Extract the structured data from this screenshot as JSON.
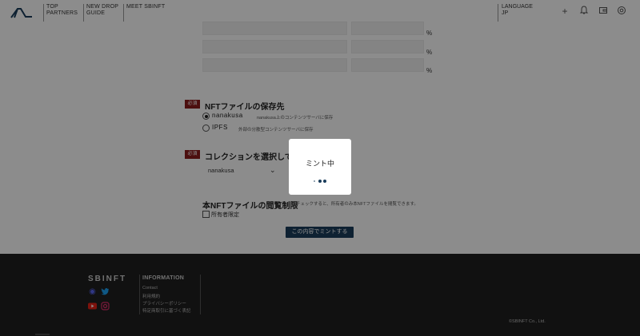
{
  "header": {
    "nav": [
      {
        "line1": "TOP",
        "line2": "PARTNERS"
      },
      {
        "line1": "NEW DROP",
        "line2": "GUIDE"
      },
      {
        "line1": "MEET SBINFT",
        "line2": ""
      }
    ],
    "language_label": "LANGUAGE",
    "language_value": "JP",
    "icons": [
      "plus-icon",
      "bell-icon",
      "wallet-icon",
      "settings-icon"
    ]
  },
  "form": {
    "percent_unit": "%",
    "required_badge": "必須",
    "storage": {
      "title": "NFTファイルの保存先",
      "options": [
        {
          "label": "nanakusa",
          "desc": "nanakusa上のコンテンツサーバに保存",
          "selected": true
        },
        {
          "label": "IPFS",
          "desc": "外部の分散型コンテンツサーバに保存",
          "selected": false
        }
      ]
    },
    "collection": {
      "title": "コレクションを選択してく",
      "selected": "nanakusa"
    },
    "view_restriction": {
      "title": "本NFTファイルの閲覧制限",
      "note": "チェックすると、所有者のみ本NFTファイルを閲覧できます。",
      "checkbox_label": "所有者限定"
    },
    "submit_label": "この内容でミントする"
  },
  "modal": {
    "title": "ミント中"
  },
  "footer": {
    "logo": "SBINFT",
    "info_title": "INFORMATION",
    "links": [
      "Contact",
      "利用規約",
      "プライバシーポリシー",
      "特定商取引に基づく表記"
    ],
    "copyright": "©SBINFT Co., Ltd.",
    "social_icons": [
      "discord-icon",
      "twitter-icon",
      "youtube-icon",
      "instagram-icon"
    ]
  }
}
